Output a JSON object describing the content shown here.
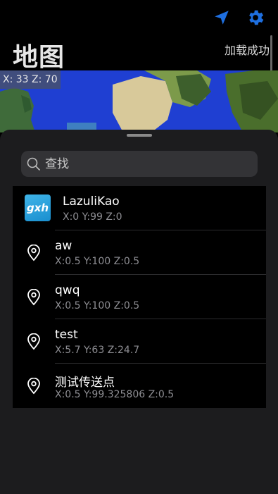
{
  "header": {
    "title": "地图",
    "load_status": "加载成功",
    "icons": [
      "navigate-arrow-icon",
      "gear-icon"
    ],
    "accent_color": "#1e6fe0"
  },
  "map": {
    "coords": "X: 33 Z: 70"
  },
  "search": {
    "placeholder": "查找"
  },
  "players": [
    {
      "avatar_text": "gxh",
      "name": "LazuliKao",
      "pos": "X:0 Y:99 Z:0"
    }
  ],
  "waypoints": [
    {
      "name": "aw",
      "pos": "X:0.5 Y:100 Z:0.5"
    },
    {
      "name": "qwq",
      "pos": "X:0.5 Y:100 Z:0.5"
    },
    {
      "name": "test",
      "pos": "X:5.7 Y:63 Z:24.7"
    },
    {
      "name": "测试传送点",
      "pos": "X:0.5 Y:99.325806 Z:0.5"
    }
  ]
}
